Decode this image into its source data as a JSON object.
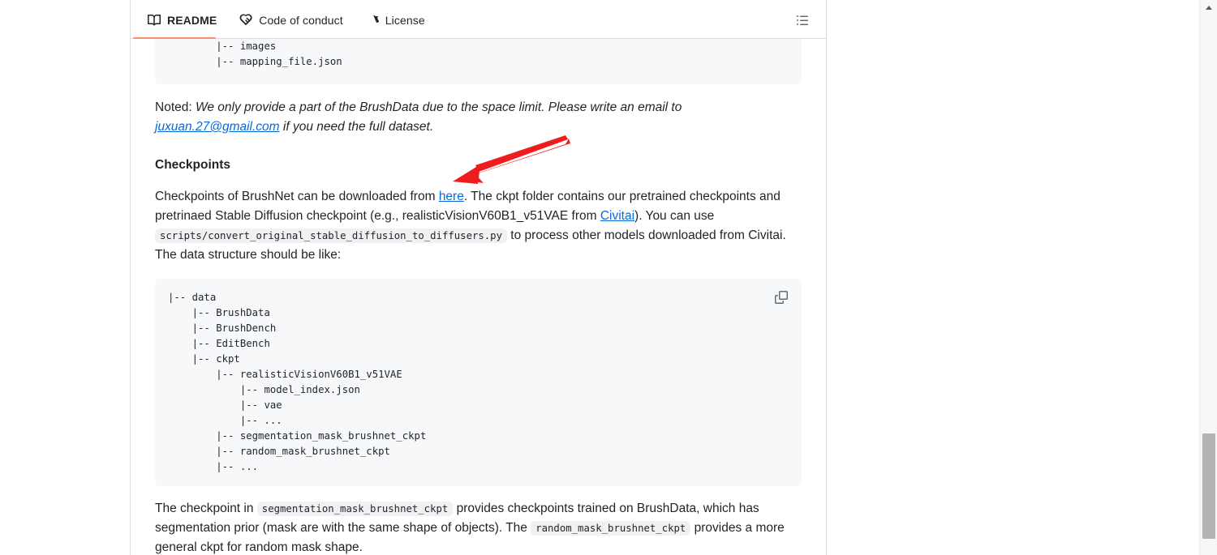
{
  "tabs": [
    {
      "label": "README",
      "icon": "book-icon",
      "active": true
    },
    {
      "label": "Code of conduct",
      "icon": "code-of-conduct-icon",
      "active": false
    },
    {
      "label": "License",
      "icon": "law-scales-icon",
      "active": false
    }
  ],
  "toolbar": {
    "outline_icon": "list-unordered-icon"
  },
  "code_block_top": {
    "lines": "        |-- images\n        |-- mapping_file.json",
    "copy_icon": "copy-icon"
  },
  "noted_paragraph": {
    "prefix": "Noted: ",
    "italic_before": "We only provide a part of the BrushData due to the space limit. Please write an email to ",
    "email_link": "juxuan.27@gmail.com",
    "italic_after": " if you need the full dataset."
  },
  "heading_checkpoints": "Checkpoints",
  "checkpoints_paragraph": {
    "part1": "Checkpoints of BrushNet can be downloaded from ",
    "link_here": "here",
    "part2": ". The ckpt folder contains our pretrained checkpoints and pretrinaed Stable Diffusion checkpoint (e.g., realisticVisionV60B1_v51VAE from ",
    "link_civitai": "Civitai",
    "part3": "). You can use ",
    "code_script": "scripts/convert_original_stable_diffusion_to_diffusers.py",
    "part4": " to process other models downloaded from Civitai. The data structure should be like:"
  },
  "code_block_data": {
    "lines": "|-- data\n    |-- BrushData\n    |-- BrushDench\n    |-- EditBench\n    |-- ckpt\n        |-- realisticVisionV60B1_v51VAE\n            |-- model_index.json\n            |-- vae\n            |-- ...\n        |-- segmentation_mask_brushnet_ckpt\n        |-- random_mask_brushnet_ckpt\n        |-- ...",
    "copy_icon": "copy-icon"
  },
  "final_paragraph": {
    "part1": "The checkpoint in ",
    "code_seg": "segmentation_mask_brushnet_ckpt",
    "part2": " provides checkpoints trained on BrushData, which has segmentation prior (mask are with the same shape of objects). The ",
    "code_rand": "random_mask_brushnet_ckpt",
    "part3": " provides a more general ckpt for random mask shape."
  },
  "annotation": {
    "type": "red-arrow",
    "color": "#ee1c1c",
    "points_to": "here"
  },
  "colors": {
    "accent_tab_underline": "#fd8c73",
    "link": "#0969da",
    "code_bg": "#f6f8fa",
    "panel_border": "#d8dee4"
  },
  "scrollbar": {
    "up_arrow_icon": "scroll-up-arrow-icon",
    "thumb": "scroll-thumb"
  }
}
